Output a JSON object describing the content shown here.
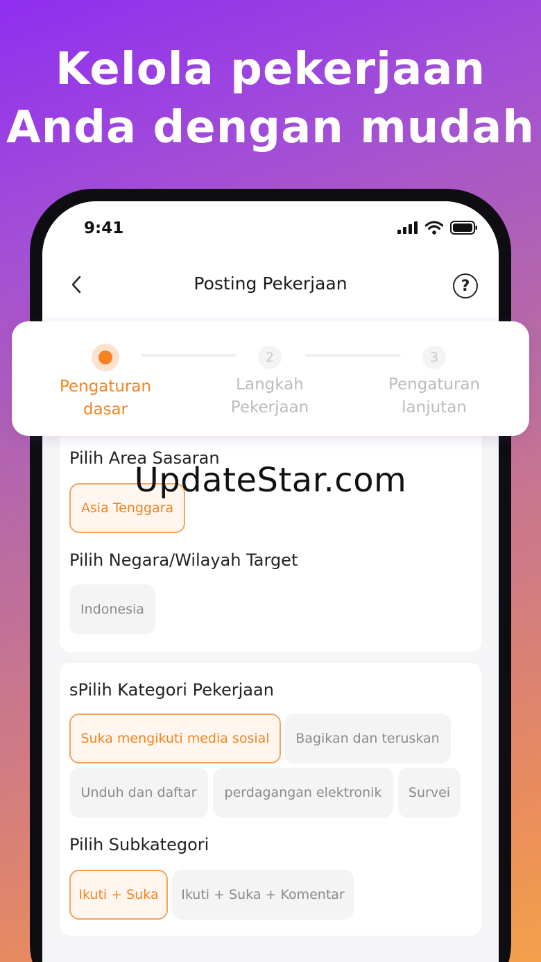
{
  "headline": {
    "line1": "Kelola pekerjaan",
    "line2": "Anda dengan mudah"
  },
  "status_bar": {
    "time": "9:41",
    "icons": [
      "signal-icon",
      "wifi-icon",
      "battery-icon"
    ]
  },
  "nav": {
    "back_icon": "chevron-left-icon",
    "title": "Posting Pekerjaan",
    "help_icon": "question-icon",
    "help_glyph": "?"
  },
  "stepper": {
    "steps": [
      {
        "number": "",
        "label_line1": "Pengaturan",
        "label_line2": "dasar",
        "state": "active"
      },
      {
        "number": "2",
        "label_line1": "Langkah",
        "label_line2": "Pekerjaan",
        "state": "idle"
      },
      {
        "number": "3",
        "label_line1": "Pengaturan",
        "label_line2": "lanjutan",
        "state": "idle"
      }
    ]
  },
  "area_section": {
    "title": "Pilih Area Sasaran",
    "options": [
      {
        "label": "Asia Tenggara",
        "selected": true
      }
    ]
  },
  "country_section": {
    "title": "Pilih Negara/Wilayah Target",
    "options": [
      {
        "label": "Indonesia",
        "selected": false
      }
    ]
  },
  "category_section": {
    "title": "sPilih Kategori Pekerjaan",
    "options": [
      {
        "label": "Suka mengikuti media sosial",
        "selected": true
      },
      {
        "label": "Bagikan dan teruskan",
        "selected": false
      },
      {
        "label": "Unduh dan daftar",
        "selected": false
      },
      {
        "label": "perdagangan elektronik",
        "selected": false
      },
      {
        "label": "Survei",
        "selected": false
      }
    ]
  },
  "subcategory_section": {
    "title": "Pilih Subkategori",
    "options": [
      {
        "label": "Ikuti + Suka",
        "selected": true
      },
      {
        "label": "Ikuti + Suka + Komentar",
        "selected": false
      }
    ]
  },
  "watermark": "UpdateStar.com",
  "colors": {
    "accent": "#f5821f",
    "chip_bg": "#f4f4f4",
    "selected_bg": "#fff7ef"
  }
}
